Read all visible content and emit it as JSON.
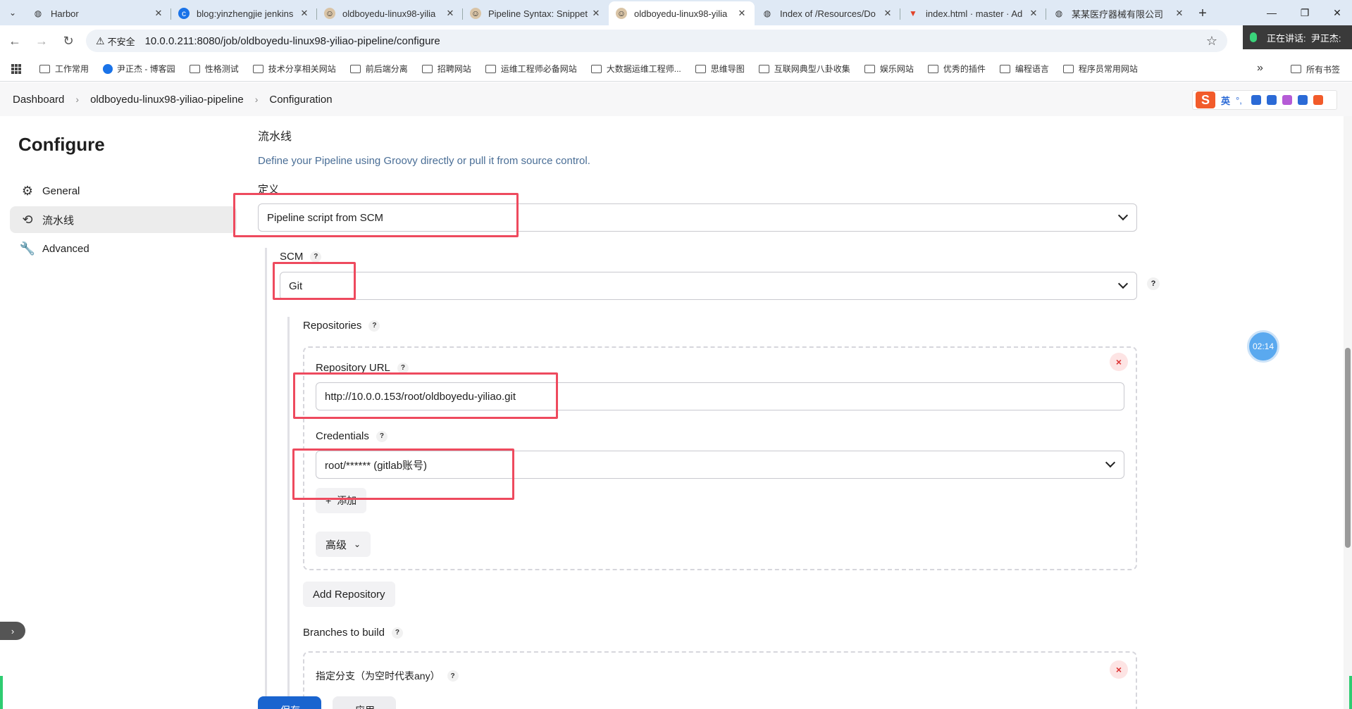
{
  "browser": {
    "tabs": [
      {
        "title": "Harbor",
        "icon": "globe-icon",
        "active": false
      },
      {
        "title": "blog:yinzhengjie jenkins",
        "icon": "blog-icon",
        "active": false
      },
      {
        "title": "oldboyedu-linux98-yilia",
        "icon": "jenkins-icon",
        "active": false
      },
      {
        "title": "Pipeline Syntax: Snippet",
        "icon": "jenkins-icon",
        "active": false
      },
      {
        "title": "oldboyedu-linux98-yilia",
        "icon": "jenkins-icon",
        "active": true
      },
      {
        "title": "Index of /Resources/Do",
        "icon": "globe-icon",
        "active": false
      },
      {
        "title": "index.html · master · Ad",
        "icon": "gitlab-icon",
        "active": false
      },
      {
        "title": "某某医疗器械有限公司",
        "icon": "globe-icon",
        "active": false
      }
    ],
    "new_tab": "+",
    "security_label": "不安全",
    "url": "10.0.0.211:8080/job/oldboyedu-linux98-yiliao-pipeline/configure",
    "speaking_label": "正在讲话:",
    "speaker": "尹正杰:",
    "bookmarks": [
      "工作常用",
      "尹正杰 - 博客园",
      "性格测试",
      "技术分享相关网站",
      "前后端分离",
      "招聘网站",
      "运维工程师必备网站",
      "大数据运维工程师...",
      "思维导图",
      "互联网典型八卦收集",
      "娱乐网站",
      "优秀的插件",
      "编程语言",
      "程序员常用网站"
    ],
    "all_bookmarks": "所有书签"
  },
  "breadcrumb": {
    "dashboard": "Dashboard",
    "job": "oldboyedu-linux98-yiliao-pipeline",
    "page": "Configuration"
  },
  "ime": {
    "logo": "S",
    "lang": "英"
  },
  "sidebar": {
    "title": "Configure",
    "items": [
      {
        "label": "General",
        "icon": "gear-icon"
      },
      {
        "label": "流水线",
        "icon": "pipeline-icon"
      },
      {
        "label": "Advanced",
        "icon": "wrench-icon"
      }
    ]
  },
  "pipeline": {
    "section_title": "流水线",
    "description": "Define your Pipeline using Groovy directly or pull it from source control.",
    "definition_label": "定义",
    "definition_value": "Pipeline script from SCM",
    "scm_label": "SCM",
    "scm_value": "Git",
    "repositories_label": "Repositories",
    "repo_url_label": "Repository URL",
    "repo_url_value": "http://10.0.0.153/root/oldboyedu-yiliao.git",
    "credentials_label": "Credentials",
    "credentials_value": "root/****** (gitlab账号)",
    "add_button": "添加",
    "advanced_button": "高级",
    "add_repository_button": "Add Repository",
    "branches_label": "Branches to build",
    "branch_specifier_label": "指定分支（为空时代表any）",
    "help_mark": "?",
    "remove_mark": "×"
  },
  "timer": "02:14",
  "footer": {
    "save": "保存",
    "apply": "应用"
  },
  "colors": {
    "highlight": "#ee4a5e",
    "primary": "#1a64cf",
    "link": "#4a6e96"
  }
}
